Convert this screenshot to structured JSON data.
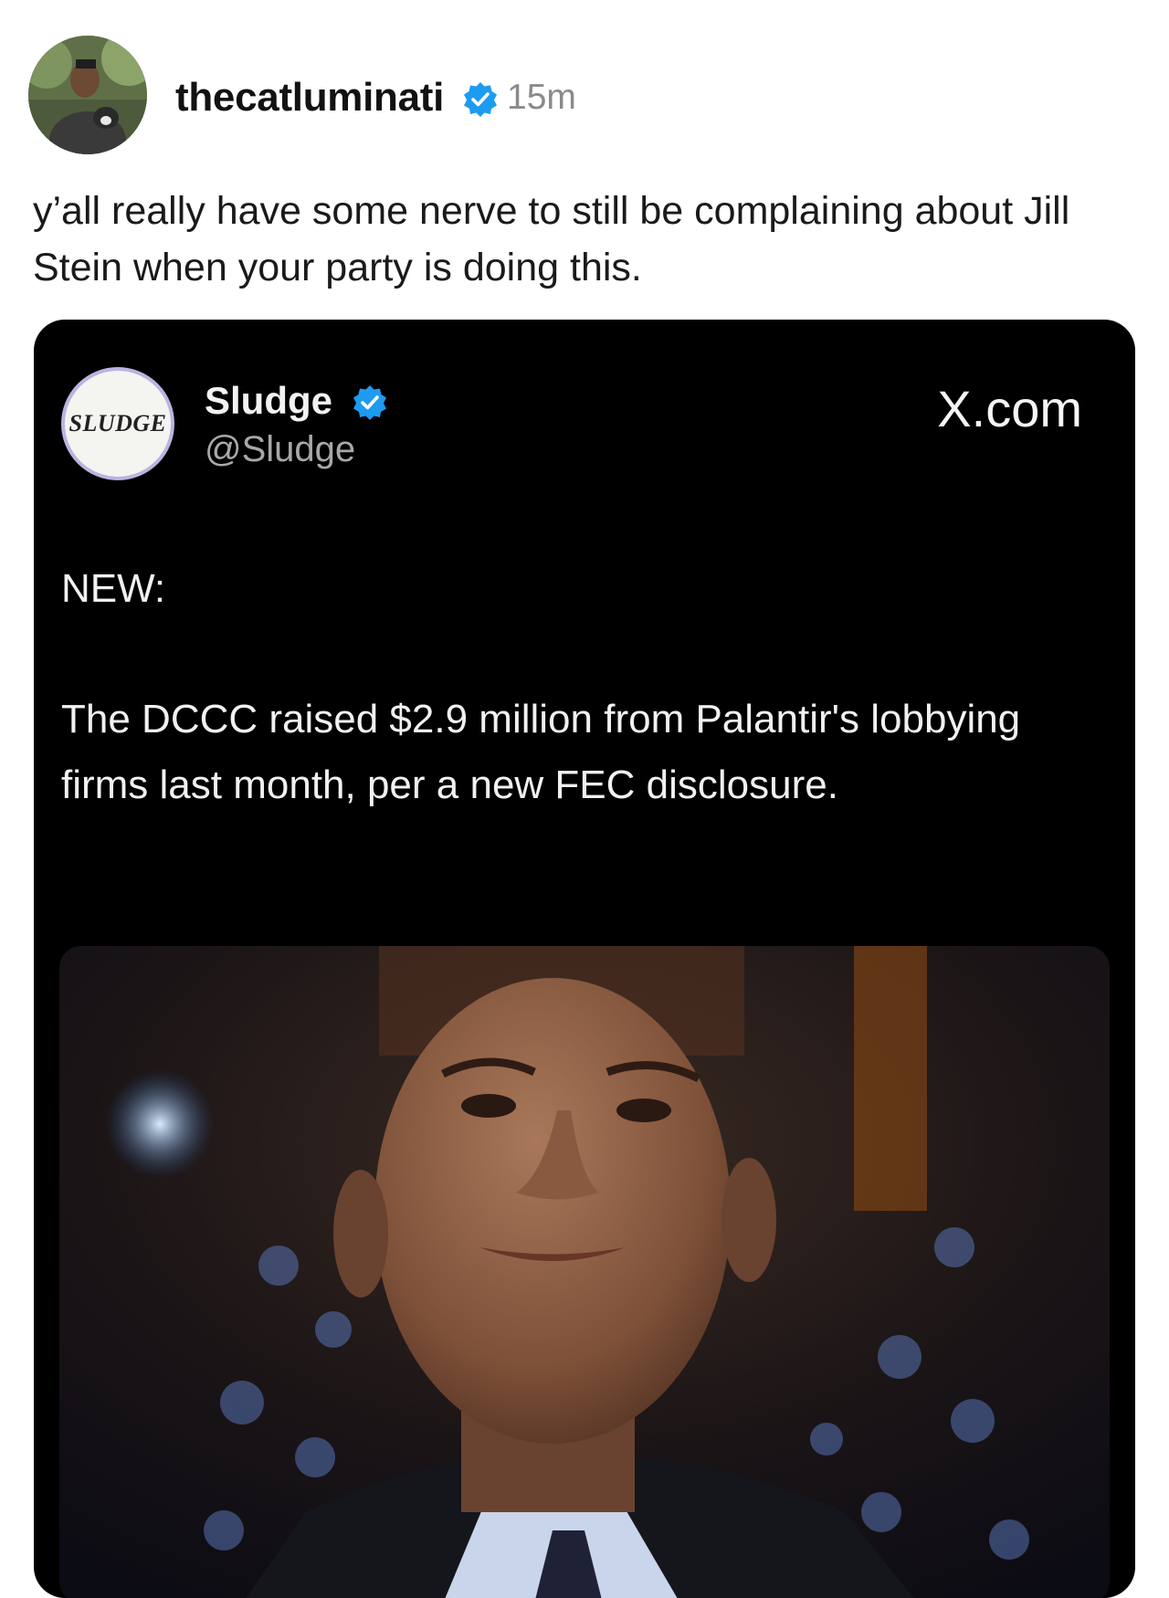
{
  "post": {
    "username": "thecatluminati",
    "timestamp": "15m",
    "text": "y’all really have some nerve to still be complaining about Jill Stein when your party is doing this.",
    "avatar_icon": "profile-photo",
    "verified_icon": "verified-badge-icon"
  },
  "embed": {
    "account_name": "Sludge",
    "account_handle": "@Sludge",
    "logo_text": "SLUDGE",
    "site": "X.com",
    "line1": "NEW:",
    "body": "The DCCC raised $2.9 million from Palantir's lobbying firms last month, per a new FEC disclosure.",
    "photo_icon": "news-photo"
  },
  "colors": {
    "verified": "#1d9bf0",
    "card_background": "#000000"
  }
}
